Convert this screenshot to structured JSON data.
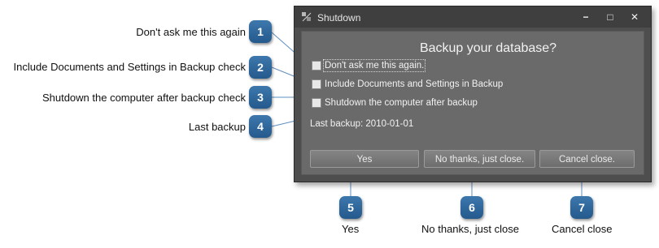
{
  "window": {
    "title": "Shutdown",
    "controls": {
      "minimize": "−",
      "maximize": "□",
      "close": "✕"
    }
  },
  "dialog": {
    "heading": "Backup your database?",
    "checkboxes": [
      {
        "label": "Don't ask me this again.",
        "checked": false,
        "focused": true
      },
      {
        "label": "Include Documents and Settings in Backup",
        "checked": false,
        "focused": false
      },
      {
        "label": "Shutdown the computer after backup",
        "checked": false,
        "focused": false
      }
    ],
    "last_backup": "Last backup: 2010-01-01",
    "buttons": {
      "yes": "Yes",
      "no_thanks": "No thanks, just close.",
      "cancel": "Cancel close."
    }
  },
  "callouts": [
    {
      "number": "1",
      "label": "Don't ask me this again"
    },
    {
      "number": "2",
      "label": "Include Documents and Settings in Backup check"
    },
    {
      "number": "3",
      "label": "Shutdown the computer after backup check"
    },
    {
      "number": "4",
      "label": "Last backup"
    },
    {
      "number": "5",
      "label": "Yes"
    },
    {
      "number": "6",
      "label": "No thanks, just close"
    },
    {
      "number": "7",
      "label": "Cancel close"
    }
  ],
  "colors": {
    "badge": "#2f6aa0",
    "window_bg": "#4e4e4e",
    "client_bg": "#6a6a6a"
  }
}
